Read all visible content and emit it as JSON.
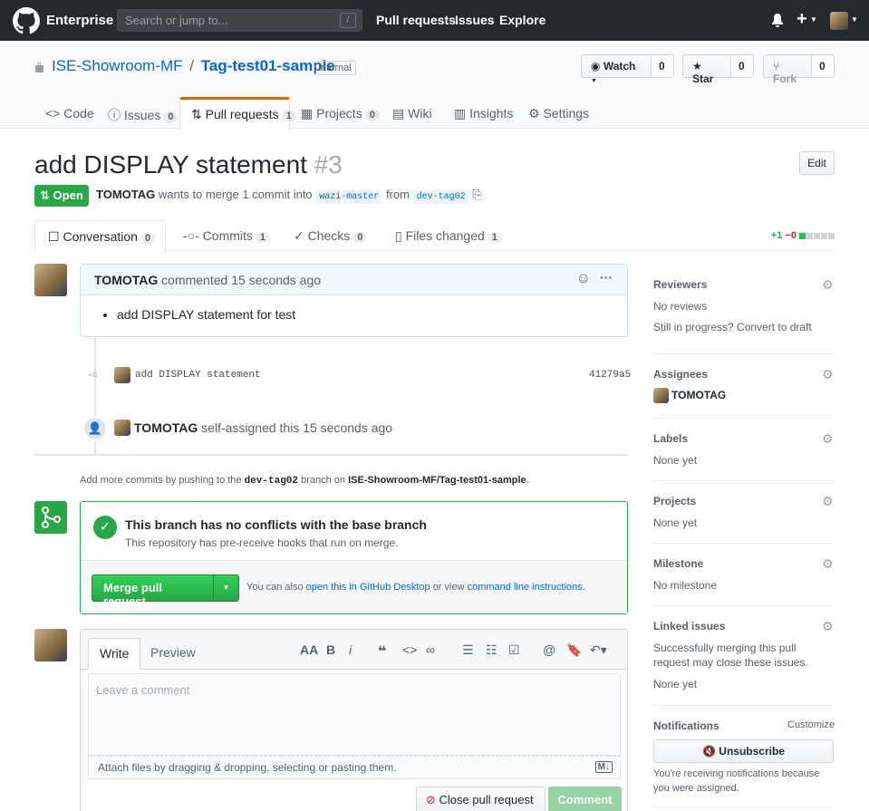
{
  "nav": {
    "brand": "Enterprise",
    "search_placeholder": "Search or jump to...",
    "search_key": "/",
    "links": [
      "Pull requests",
      "Issues",
      "Explore"
    ]
  },
  "repo": {
    "owner": "ISE-Showroom-MF",
    "sep": "/",
    "name": "Tag-test01-sample",
    "visibility": "Internal",
    "watch_label": "Watch",
    "watch_count": "0",
    "star_label": "Star",
    "star_count": "0",
    "fork_label": "Fork",
    "fork_count": "0",
    "tabs": [
      {
        "label": "Code"
      },
      {
        "label": "Issues",
        "count": "0"
      },
      {
        "label": "Pull requests",
        "count": "1"
      },
      {
        "label": "Projects",
        "count": "0"
      },
      {
        "label": "Wiki"
      },
      {
        "label": "Insights"
      },
      {
        "label": "Settings"
      }
    ]
  },
  "pr": {
    "title": "add DISPLAY statement",
    "number": "#3",
    "edit_label": "Edit",
    "state": "Open",
    "author": "TOMOTAG",
    "meta_text": "wants to merge 1 commit into",
    "base": "wazi-master",
    "from_text": "from",
    "head": "dev-tag02",
    "tabs": [
      {
        "label": "Conversation",
        "count": "0"
      },
      {
        "label": "Commits",
        "count": "1"
      },
      {
        "label": "Checks",
        "count": "0"
      },
      {
        "label": "Files changed",
        "count": "1"
      }
    ],
    "additions": "+1",
    "deletions": "−0"
  },
  "timeline": {
    "comment_author": "TOMOTAG",
    "comment_meta": "commented 15 seconds ago",
    "comment_body": "add DISPLAY statement for test",
    "commit_msg": "add DISPLAY statement",
    "commit_sha": "41279a5",
    "assign_user": "TOMOTAG",
    "assign_text": "self-assigned this 15 seconds ago",
    "hint_pre": "Add more commits by pushing to the",
    "hint_branch": "dev-tag02",
    "hint_mid": "branch on",
    "hint_repo": "ISE-Showroom-MF/Tag-test01-sample",
    "hint_end": "."
  },
  "merge": {
    "title": "This branch has no conflicts with the base branch",
    "subtitle": "This repository has pre-receive hooks that run on merge.",
    "button": "Merge pull request",
    "also_text": "You can also",
    "desktop_link": "open this in GitHub Desktop",
    "or_view": "or view",
    "cli_link": "command line instructions",
    "end": "."
  },
  "editor": {
    "write_tab": "Write",
    "preview_tab": "Preview",
    "placeholder": "Leave a comment",
    "attach_text": "Attach files by dragging & dropping, selecting or pasting them.",
    "close_button": "Close pull request",
    "comment_button": "Comment"
  },
  "sidebar": {
    "reviewers": {
      "title": "Reviewers",
      "value": "No reviews",
      "extra": "Still in progress? Convert to draft"
    },
    "assignees": {
      "title": "Assignees",
      "value": "TOMOTAG"
    },
    "labels": {
      "title": "Labels",
      "value": "None yet"
    },
    "projects": {
      "title": "Projects",
      "value": "None yet"
    },
    "milestone": {
      "title": "Milestone",
      "value": "No milestone"
    },
    "linked": {
      "title": "Linked issues",
      "desc": "Successfully merging this pull request may close these issues.",
      "value": "None yet"
    },
    "notifications": {
      "title": "Notifications",
      "customize": "Customize",
      "button": "Unsubscribe",
      "desc": "You're receiving notifications because you were assigned."
    }
  }
}
